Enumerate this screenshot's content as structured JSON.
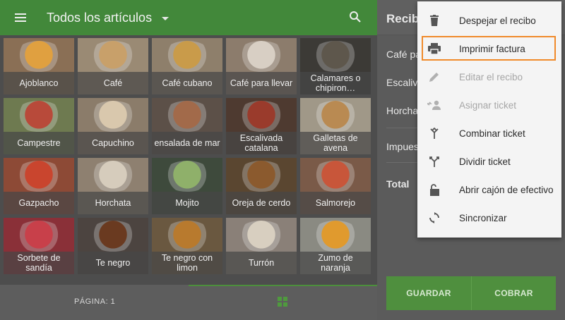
{
  "appbar": {
    "title": "Todos los artículos"
  },
  "tiles": [
    {
      "label": "Ajoblanco",
      "bg": "#8a6f55",
      "art": "#e0a040"
    },
    {
      "label": "Café",
      "bg": "#9a8a74",
      "art": "#c8a06a"
    },
    {
      "label": "Café cubano",
      "bg": "#8e7f6b",
      "art": "#c99b4a"
    },
    {
      "label": "Café para llevar",
      "bg": "#8c7c6c",
      "art": "#d8cfc4"
    },
    {
      "label": "Calamares o chipiron…",
      "bg": "#3c3a36",
      "art": "#5e574c"
    },
    {
      "label": "Campestre",
      "bg": "#6e7a50",
      "art": "#b84a3a"
    },
    {
      "label": "Capuchino",
      "bg": "#8b7c6a",
      "art": "#d9c8ad"
    },
    {
      "label": "ensalada de mar",
      "bg": "#5c5048",
      "art": "#a26a4a"
    },
    {
      "label": "Escalivada catalana",
      "bg": "#4e3a30",
      "art": "#9a3b2c"
    },
    {
      "label": "Galletas de avena",
      "bg": "#a09888",
      "art": "#b98a52"
    },
    {
      "label": "Gazpacho",
      "bg": "#8d4a36",
      "art": "#c9452e"
    },
    {
      "label": "Horchata",
      "bg": "#8e8070",
      "art": "#d6ccbc"
    },
    {
      "label": "Mojito",
      "bg": "#3e4a3c",
      "art": "#8fb06a"
    },
    {
      "label": "Oreja de cerdo",
      "bg": "#5a4630",
      "art": "#8b5a2e"
    },
    {
      "label": "Salmorejo",
      "bg": "#7a5a48",
      "art": "#c8563a"
    },
    {
      "label": "Sorbete de sandía",
      "bg": "#8a3038",
      "art": "#c8404a"
    },
    {
      "label": "Te negro",
      "bg": "#4c4440",
      "art": "#6a3a20"
    },
    {
      "label": "Te negro con limon",
      "bg": "#6a5840",
      "art": "#b87a2e"
    },
    {
      "label": "Turrón",
      "bg": "#8a8078",
      "art": "#d8cfc0"
    },
    {
      "label": "Zumo de naranja",
      "bg": "#8a8a82",
      "art": "#e09a2e"
    }
  ],
  "bottom": {
    "page_label": "PÁGINA: 1"
  },
  "receipt": {
    "title": "Recibo",
    "items": [
      "Café pa",
      "Escaliva",
      "Horchat"
    ],
    "taxes": "Impues",
    "total": "Total"
  },
  "buttons": {
    "save": "GUARDAR",
    "charge": "COBRAR"
  },
  "menu": {
    "items": [
      {
        "label": "Despejar el recibo",
        "icon": "trash-icon",
        "enabled": true
      },
      {
        "label": "Imprimir factura",
        "icon": "printer-icon",
        "enabled": true
      },
      {
        "label": "Editar el recibo",
        "icon": "pencil-icon",
        "enabled": false
      },
      {
        "label": "Asignar ticket",
        "icon": "assign-user-icon",
        "enabled": false
      },
      {
        "label": "Combinar ticket",
        "icon": "merge-icon",
        "enabled": true
      },
      {
        "label": "Dividir ticket",
        "icon": "split-icon",
        "enabled": true
      },
      {
        "label": "Abrir cajón de efectivo",
        "icon": "cash-drawer-icon",
        "enabled": true
      },
      {
        "label": "Sincronizar",
        "icon": "sync-icon",
        "enabled": true
      }
    ]
  },
  "colors": {
    "accent": "#42883a",
    "highlight": "#f08a2a"
  }
}
